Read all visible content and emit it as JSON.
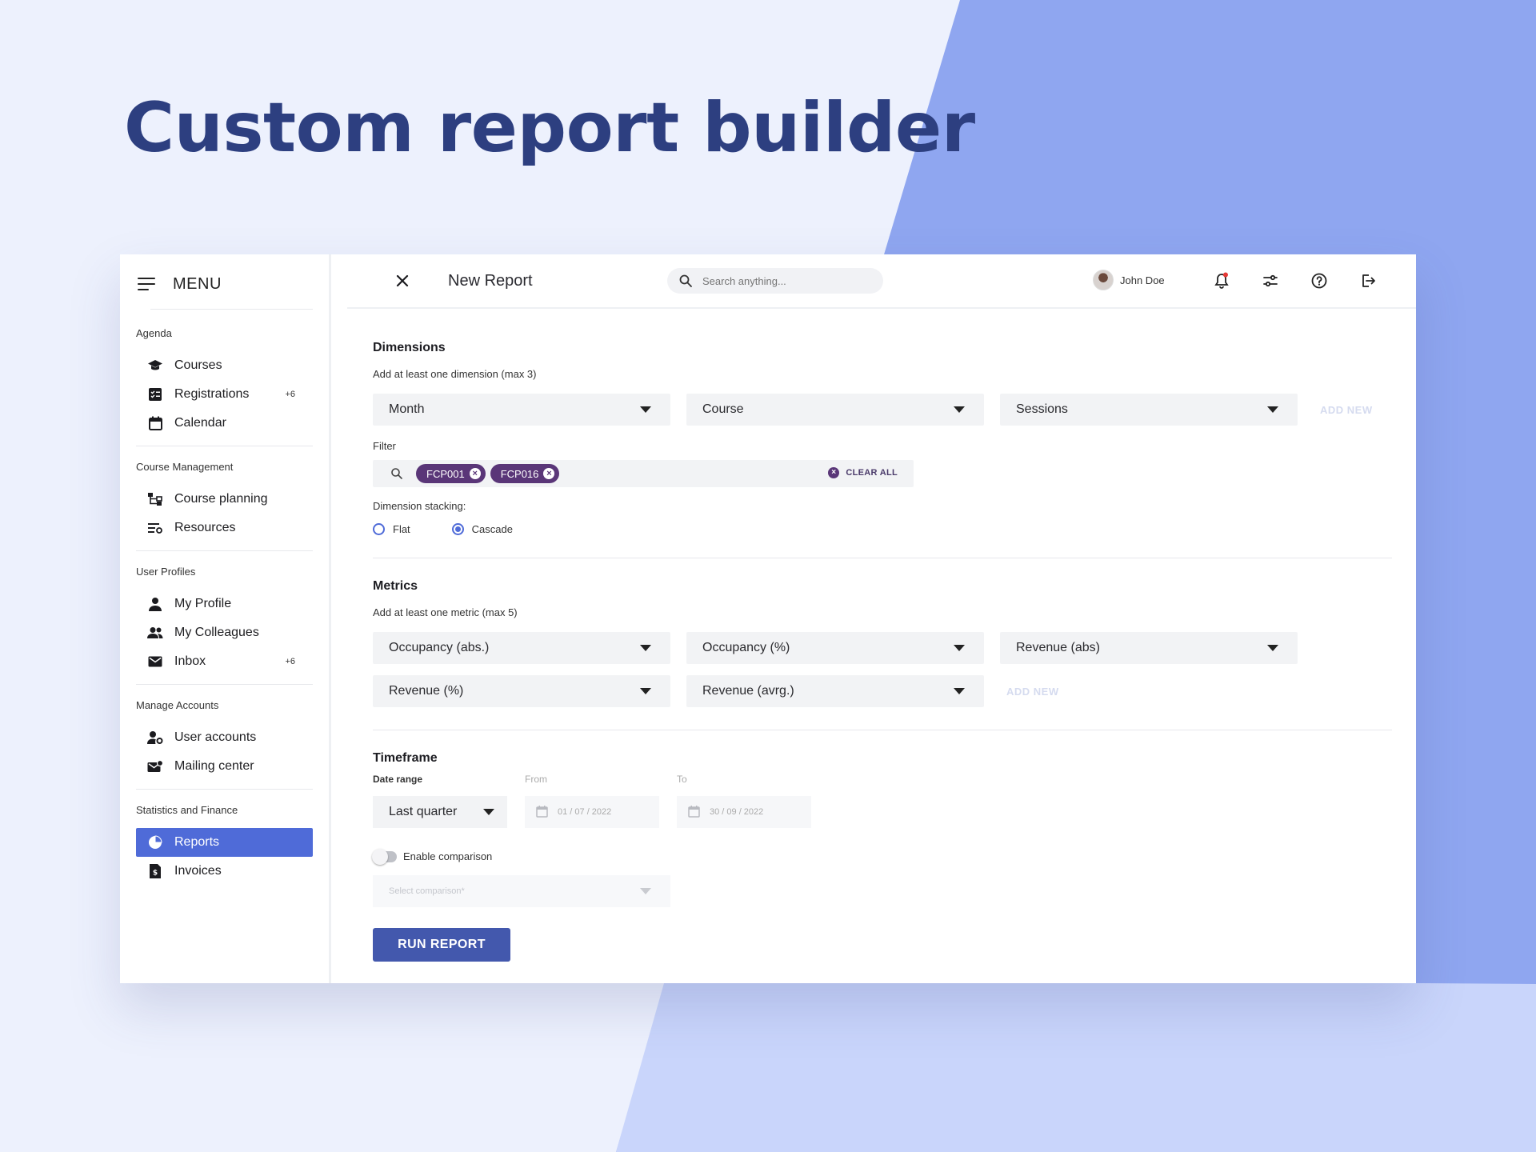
{
  "hero": {
    "title": "Custom report builder"
  },
  "sidebar": {
    "menu_label": "MENU",
    "groups": [
      {
        "title": "Agenda",
        "items": [
          {
            "label": "Courses",
            "icon": "graduation-cap-icon",
            "badge": ""
          },
          {
            "label": "Registrations",
            "icon": "registrations-icon",
            "badge": "+6"
          },
          {
            "label": "Calendar",
            "icon": "calendar-icon",
            "badge": ""
          }
        ]
      },
      {
        "title": "Course Management",
        "items": [
          {
            "label": "Course planning",
            "icon": "course-planning-icon",
            "badge": ""
          },
          {
            "label": "Resources",
            "icon": "resources-icon",
            "badge": ""
          }
        ]
      },
      {
        "title": "User Profiles",
        "items": [
          {
            "label": "My Profile",
            "icon": "person-icon",
            "badge": ""
          },
          {
            "label": "My Colleagues",
            "icon": "people-icon",
            "badge": ""
          },
          {
            "label": "Inbox",
            "icon": "envelope-icon",
            "badge": "+6"
          }
        ]
      },
      {
        "title": "Manage Accounts",
        "items": [
          {
            "label": "User accounts",
            "icon": "user-accounts-icon",
            "badge": ""
          },
          {
            "label": "Mailing center",
            "icon": "mailing-icon",
            "badge": ""
          }
        ]
      },
      {
        "title": "Statistics and Finance",
        "items": [
          {
            "label": "Reports",
            "icon": "pie-chart-icon",
            "badge": "",
            "active": true
          },
          {
            "label": "Invoices",
            "icon": "invoice-icon",
            "badge": ""
          }
        ]
      }
    ]
  },
  "topbar": {
    "title": "New Report",
    "search_placeholder": "Search anything...",
    "user_name": "John Doe"
  },
  "dimensions": {
    "title": "Dimensions",
    "subtitle": "Add at least one dimension (max 3)",
    "selects": [
      "Month",
      "Course",
      "Sessions"
    ],
    "add_new": "ADD NEW",
    "filter_label": "Filter",
    "chips": [
      "FCP001",
      "FCP016"
    ],
    "clear_all": "CLEAR ALL",
    "stacking_label": "Dimension stacking:",
    "stacking_options": [
      "Flat",
      "Cascade"
    ],
    "stacking_selected": "Cascade"
  },
  "metrics": {
    "title": "Metrics",
    "subtitle": "Add at least one metric (max 5)",
    "row1": [
      "Occupancy (abs.)",
      "Occupancy (%)",
      "Revenue (abs)"
    ],
    "row2": [
      "Revenue (%)",
      "Revenue (avrg.)"
    ],
    "add_new": "ADD NEW"
  },
  "timeframe": {
    "title": "Timeframe",
    "date_range_label": "Date range",
    "date_range_value": "Last quarter",
    "from_label": "From",
    "from_value": "01 / 07 / 2022",
    "to_label": "To",
    "to_value": "30 / 09 / 2022",
    "comparison_toggle_label": "Enable comparison",
    "comparison_placeholder": "Select comparison*"
  },
  "run_button": "RUN REPORT",
  "colors": {
    "accent": "#4f6bd8",
    "chip": "#5a3678",
    "run": "#4358ad",
    "hero": "#2d3f80"
  }
}
